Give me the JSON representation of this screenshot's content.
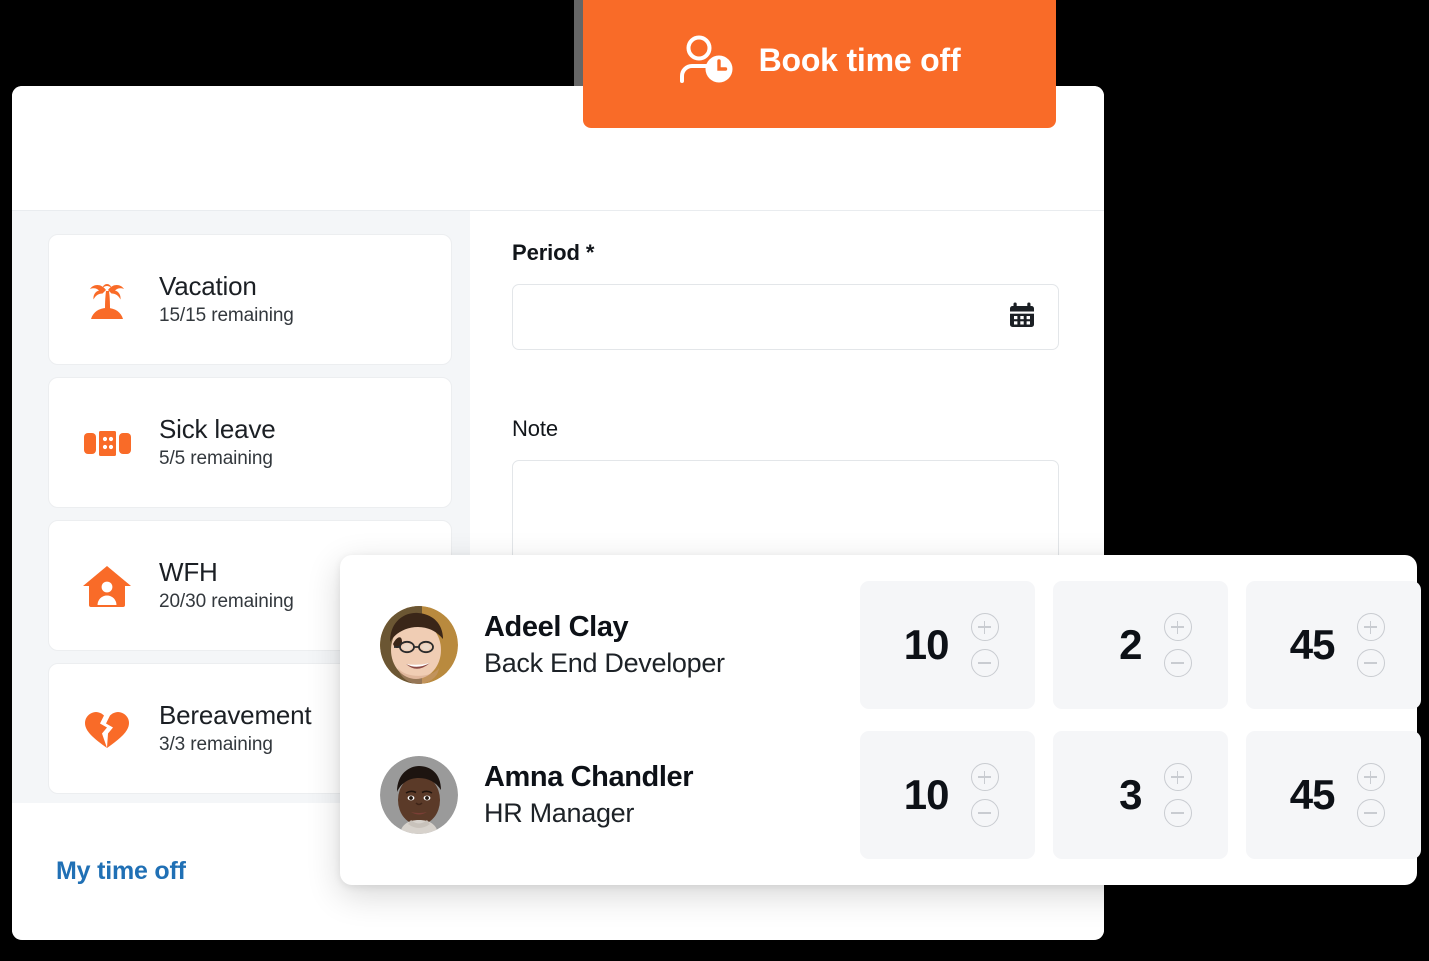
{
  "theme": {
    "accent_orange": "#F96B28",
    "link_blue": "#2070B5",
    "page_background": "#000000",
    "panel_background": "#F4F6F8",
    "stepper_background": "#F5F6F8"
  },
  "book_button": {
    "label": "Book time off",
    "icon": "person-clock-icon"
  },
  "sidebar": {
    "items": [
      {
        "title": "Vacation",
        "remaining": "15/15 remaining",
        "icon": "palm-tree-icon"
      },
      {
        "title": "Sick leave",
        "remaining": "5/5 remaining",
        "icon": "bandage-icon"
      },
      {
        "title": "WFH",
        "remaining": "20/30 remaining",
        "icon": "house-person-icon"
      },
      {
        "title": "Bereavement",
        "remaining": "3/3 remaining",
        "icon": "broken-heart-icon"
      }
    ]
  },
  "form": {
    "period": {
      "label": "Period *",
      "value": "",
      "placeholder": "",
      "icon": "calendar-icon"
    },
    "note": {
      "label": "Note",
      "value": "",
      "placeholder": ""
    }
  },
  "footer": {
    "my_time_off_label": "My time off"
  },
  "employee_panel": {
    "rows": [
      {
        "name": "Adeel Clay",
        "role": "Back End Developer",
        "avatar": "avatar-adeel-clay",
        "steppers": [
          {
            "value": "10",
            "increment_icon": "plus-circle-icon",
            "decrement_icon": "minus-circle-icon"
          },
          {
            "value": "2",
            "increment_icon": "plus-circle-icon",
            "decrement_icon": "minus-circle-icon"
          },
          {
            "value": "45",
            "increment_icon": "plus-circle-icon",
            "decrement_icon": "minus-circle-icon"
          }
        ]
      },
      {
        "name": "Amna Chandler",
        "role": "HR Manager",
        "avatar": "avatar-amna-chandler",
        "steppers": [
          {
            "value": "10",
            "increment_icon": "plus-circle-icon",
            "decrement_icon": "minus-circle-icon"
          },
          {
            "value": "3",
            "increment_icon": "plus-circle-icon",
            "decrement_icon": "minus-circle-icon"
          },
          {
            "value": "45",
            "increment_icon": "plus-circle-icon",
            "decrement_icon": "minus-circle-icon"
          }
        ]
      }
    ]
  }
}
